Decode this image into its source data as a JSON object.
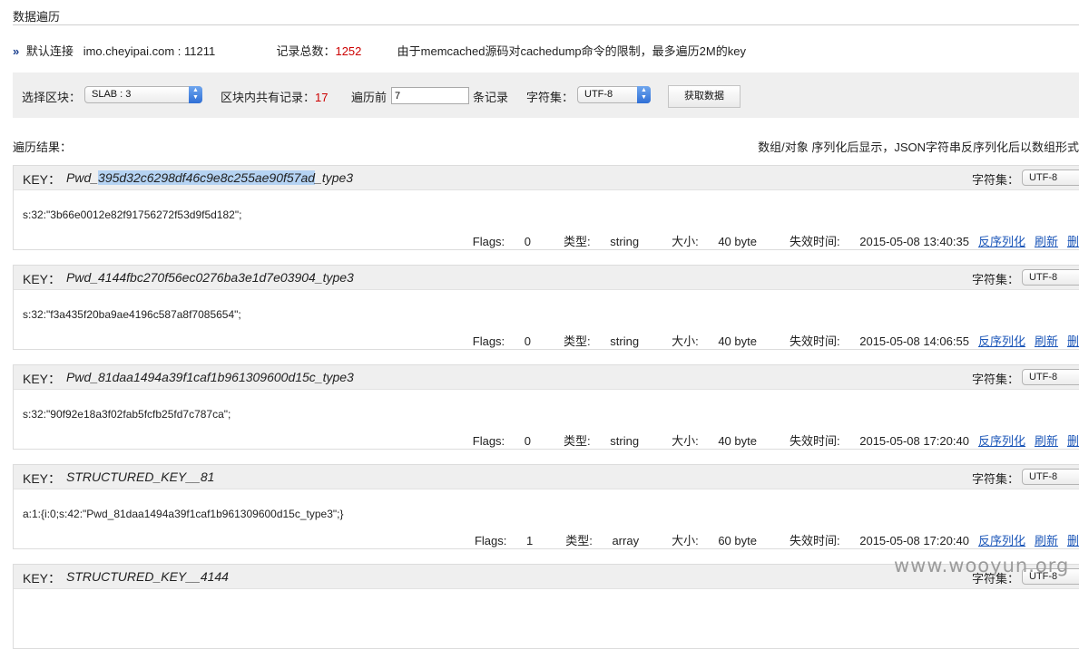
{
  "page": {
    "title": "数据遍历"
  },
  "connection": {
    "label": "默认连接",
    "host": "imo.cheyipai.com : 11211",
    "total_label": "记录总数：",
    "total_value": "1252",
    "notice": "由于memcached源码对cachedump命令的限制，最多遍历2M的key"
  },
  "toolbar": {
    "slab_label": "选择区块：",
    "slab_value": "SLAB : 3",
    "slab_count_label": "区块内共有记录：",
    "slab_count_value": "17",
    "traverse_label": "遍历前",
    "traverse_value": "7",
    "records_suffix": "条记录",
    "charset_label": "字符集：",
    "charset_value": "UTF-8",
    "fetch_button": "获取数据"
  },
  "results": {
    "label": "遍历结果：",
    "note": "数组/对象 序列化后显示，JSON字符串反序列化后以数组形式"
  },
  "labels": {
    "key": "KEY：",
    "charset": "字符集：",
    "flags": "Flags:",
    "type": "类型:",
    "size": "大小:",
    "expire": "失效时间:",
    "unserialize": "反序列化",
    "refresh": "刷新",
    "delete": "删"
  },
  "records": [
    {
      "key_prefix": "Pwd_",
      "key_highlight": "395d32c6298df46c9e8c255ae90f57ad",
      "key_suffix": "_type3",
      "charset": "UTF-8",
      "value": "s:32:\"3b66e0012e82f91756272f53d9f5d182\";",
      "flags": "0",
      "type": "string",
      "size": "40 byte",
      "expire": "2015-05-08 13:40:35"
    },
    {
      "key_prefix": "Pwd_4144fbc270f56ec0276ba3e1d7e03904_type3",
      "key_highlight": "",
      "key_suffix": "",
      "charset": "UTF-8",
      "value": "s:32:\"f3a435f20ba9ae4196c587a8f7085654\";",
      "flags": "0",
      "type": "string",
      "size": "40 byte",
      "expire": "2015-05-08 14:06:55"
    },
    {
      "key_prefix": "Pwd_81daa1494a39f1caf1b961309600d15c_type3",
      "key_highlight": "",
      "key_suffix": "",
      "charset": "UTF-8",
      "value": "s:32:\"90f92e18a3f02fab5fcfb25fd7c787ca\";",
      "flags": "0",
      "type": "string",
      "size": "40 byte",
      "expire": "2015-05-08 17:20:40"
    },
    {
      "key_prefix": "STRUCTURED_KEY__81",
      "key_highlight": "",
      "key_suffix": "",
      "charset": "UTF-8",
      "value": "a:1:{i:0;s:42:\"Pwd_81daa1494a39f1caf1b961309600d15c_type3\";}",
      "flags": "1",
      "type": "array",
      "size": "60 byte",
      "expire": "2015-05-08 17:20:40"
    },
    {
      "key_prefix": "STRUCTURED_KEY__4144",
      "key_highlight": "",
      "key_suffix": "",
      "charset": "UTF-8",
      "value": "",
      "flags": "",
      "type": "",
      "size": "",
      "expire": ""
    }
  ],
  "watermark": "www.wooyun.org"
}
